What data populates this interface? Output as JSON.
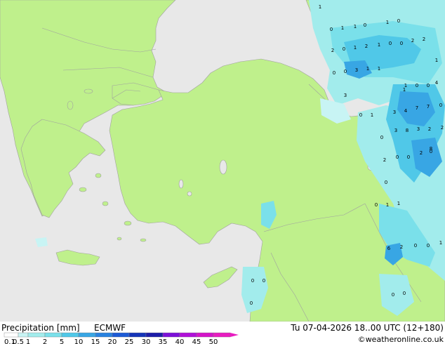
{
  "product": {
    "title": "Precipitation [mm]",
    "model": "ECMWF"
  },
  "valid_time": "Tu 07-04-2026 18..00 UTC (12+180)",
  "credit": "©weatheronline.co.uk",
  "colors": {
    "land": "#bff08c",
    "sea": "#e8e8e8",
    "coast": "#a0a0a0"
  },
  "legend": {
    "ticks": [
      "0.1",
      "0.5",
      "1",
      "2",
      "5",
      "10",
      "15",
      "20",
      "25",
      "30",
      "35",
      "40",
      "45",
      "50"
    ],
    "colors": [
      "#ffffff",
      "#c8f4f4",
      "#a2ecec",
      "#7ae0ea",
      "#50c8e8",
      "#38a6e4",
      "#2882e0",
      "#1c5ad6",
      "#1434b8",
      "#1c1ca8",
      "#7c10d8",
      "#b010d8",
      "#d414c8",
      "#e81cc0"
    ]
  },
  "point_labels": [
    {
      "text": "1"
    },
    {
      "text": "1"
    },
    {
      "text": "0"
    },
    {
      "text": "0"
    },
    {
      "text": "1"
    },
    {
      "text": "1"
    },
    {
      "text": "0"
    },
    {
      "text": "2"
    },
    {
      "text": "0"
    },
    {
      "text": "1"
    },
    {
      "text": "2"
    },
    {
      "text": "1"
    },
    {
      "text": "0"
    },
    {
      "text": "0"
    },
    {
      "text": "2"
    },
    {
      "text": "2"
    },
    {
      "text": "1"
    },
    {
      "text": "0"
    },
    {
      "text": "0"
    },
    {
      "text": "3"
    },
    {
      "text": "1"
    },
    {
      "text": "1"
    },
    {
      "text": "3"
    },
    {
      "text": "1"
    },
    {
      "text": "0"
    },
    {
      "text": "0"
    },
    {
      "text": "4"
    },
    {
      "text": "1"
    },
    {
      "text": "3"
    },
    {
      "text": "4"
    },
    {
      "text": "7"
    },
    {
      "text": "7"
    },
    {
      "text": "0"
    },
    {
      "text": "0"
    },
    {
      "text": "1"
    },
    {
      "text": "0"
    },
    {
      "text": "3"
    },
    {
      "text": "8"
    },
    {
      "text": "3"
    },
    {
      "text": "2"
    },
    {
      "text": "2"
    },
    {
      "text": "2"
    },
    {
      "text": "0"
    },
    {
      "text": "2"
    },
    {
      "text": "0"
    },
    {
      "text": "0"
    },
    {
      "text": "8"
    },
    {
      "text": "0"
    },
    {
      "text": "0"
    },
    {
      "text": "1"
    },
    {
      "text": "1"
    },
    {
      "text": "6"
    },
    {
      "text": "2"
    },
    {
      "text": "0"
    },
    {
      "text": "0"
    },
    {
      "text": "1"
    },
    {
      "text": "0"
    },
    {
      "text": "0"
    },
    {
      "text": "0"
    },
    {
      "text": "0"
    },
    {
      "text": "0"
    }
  ]
}
